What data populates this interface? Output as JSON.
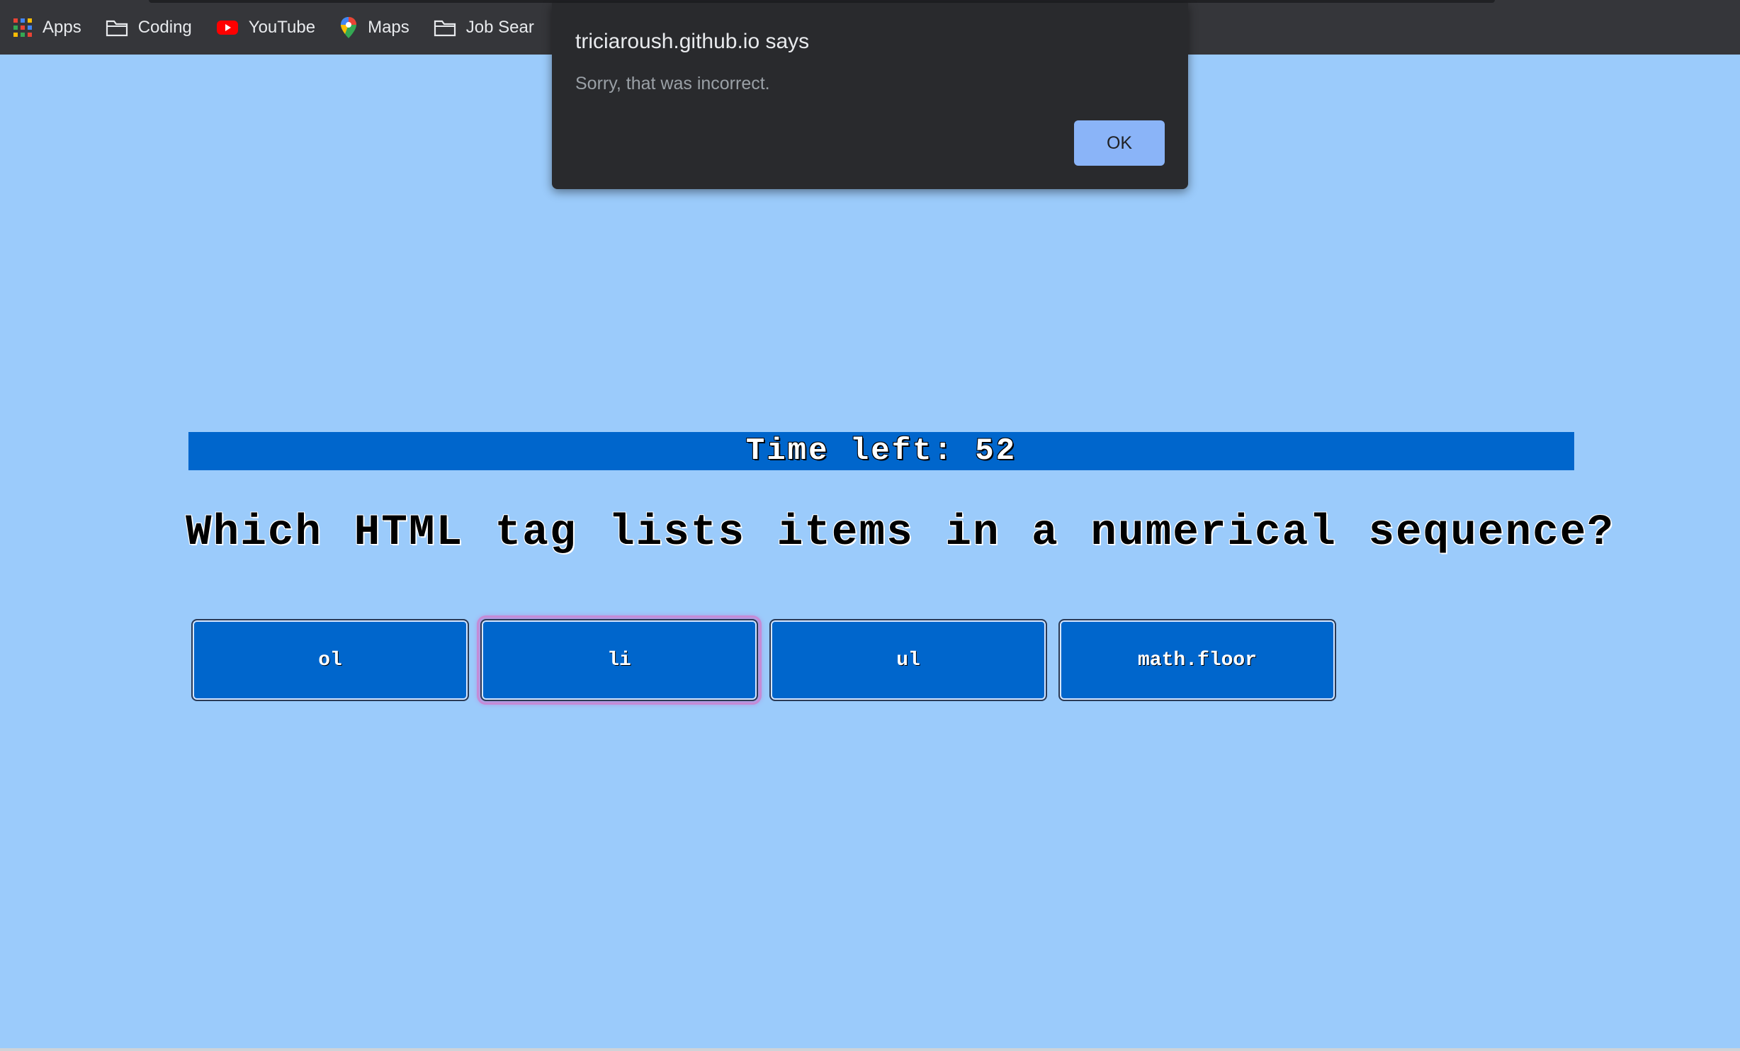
{
  "bookmarks": {
    "items": [
      {
        "label": "Apps",
        "icon": "apps-grid-icon"
      },
      {
        "label": "Coding",
        "icon": "folder-icon"
      },
      {
        "label": "YouTube",
        "icon": "youtube-icon"
      },
      {
        "label": "Maps",
        "icon": "maps-pin-icon"
      },
      {
        "label": "Job Sear",
        "icon": "folder-icon"
      }
    ]
  },
  "alert": {
    "title": "triciaroush.github.io says",
    "message": "Sorry, that was incorrect.",
    "ok_label": "OK"
  },
  "quiz": {
    "timer_text": "Time left: 52",
    "question": "Which HTML tag lists items in a numerical sequence?",
    "answers": [
      {
        "label": "ol"
      },
      {
        "label": "li"
      },
      {
        "label": "ul"
      },
      {
        "label": "math.floor"
      }
    ]
  },
  "colors": {
    "page_background": "#9bcbfb",
    "accent_blue": "#0066cc",
    "dialog_background": "#292a2d",
    "ok_button": "#8ab4f8"
  }
}
